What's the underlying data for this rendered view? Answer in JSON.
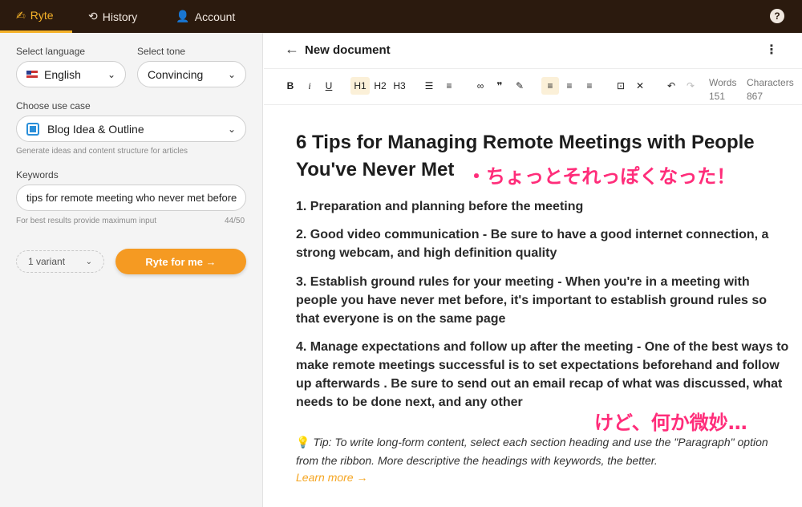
{
  "nav": {
    "tabs": [
      {
        "label": "Ryte",
        "icon": "ryte-logo-icon"
      },
      {
        "label": "History",
        "icon": "history-icon"
      },
      {
        "label": "Account",
        "icon": "person-icon"
      }
    ],
    "help_icon": "?"
  },
  "left": {
    "language_label": "Select language",
    "language_value": "English",
    "tone_label": "Select tone",
    "tone_value": "Convincing",
    "use_case_label": "Choose use case",
    "use_case_value": "Blog Idea & Outline",
    "use_case_hint": "Generate ideas and content structure for articles",
    "keywords_label": "Keywords",
    "keywords_value": "tips for remote meeting who never met before",
    "keywords_hint": "For best results provide maximum input",
    "keywords_count": "44/50",
    "variant_value": "1 variant",
    "ryte_button": "Ryte for me →"
  },
  "editor": {
    "title": "New document",
    "toolbar": {
      "bold": "B",
      "italic": "i",
      "underline": "U",
      "h1": "H1",
      "h2": "H2",
      "h3": "H3",
      "quote": "❞"
    },
    "words_label": "Words",
    "words_value": "151",
    "chars_label": "Characters",
    "chars_value": "867",
    "heading": "6 Tips for Managing Remote Meetings with People You've Never Met",
    "paragraphs": [
      "1. Preparation and planning before the meeting",
      "2. Good video communication - Be sure to have a good internet connection, a strong webcam, and high definition quality",
      "3. Establish ground rules for your meeting - When you're in a meeting with people you have never met before, it's important to establish ground rules so that everyone is on the same page",
      "4. Manage expectations and follow up after the meeting - One of the best ways to make remote meetings successful is to set expectations beforehand and follow up afterwards . Be sure to send out an email recap of what was discussed, what needs to be done next, and any other"
    ],
    "tip": "Tip: To write long-form content, select each section heading and use the \"Paragraph\" option from the ribbon. More descriptive the headings with keywords, the better.",
    "learn_more": "Learn more →"
  },
  "annotations": {
    "top": "・ちょっとそれっぽくなった！",
    "bottom": "けど、何か微妙…"
  },
  "colors": {
    "topbar": "#2b1a0e",
    "accent": "#f5b229",
    "button": "#f59a22",
    "annotation": "#ff2d7a"
  }
}
